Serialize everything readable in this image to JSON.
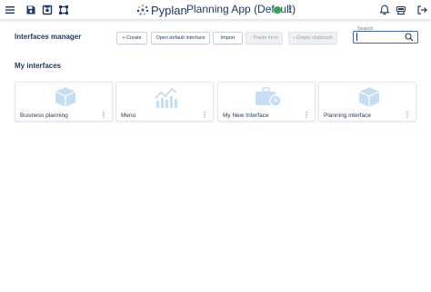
{
  "topbar": {
    "logo_text": "Pyplan",
    "app_title": "Planning App (Default)",
    "status_color": "#2fa84f",
    "left_icons": [
      "menu-icon",
      "save-icon",
      "save-as-icon",
      "crop-icon"
    ],
    "right_icons": [
      "bell-icon",
      "support-icon",
      "logout-icon"
    ]
  },
  "manager": {
    "title": "Interfaces manager",
    "buttons": {
      "create": "+ Create",
      "open_default": "Open default interface",
      "import": "Import",
      "paste": "Paste here",
      "empty_clipboard": "Empty clipboard"
    },
    "search": {
      "label": "Search",
      "value": ""
    }
  },
  "section": {
    "title": "My interfaces"
  },
  "cards": [
    {
      "label": "Business planning",
      "icon": "cube-icon"
    },
    {
      "label": "Menu",
      "icon": "chart-icon"
    },
    {
      "label": "My New Interface",
      "icon": "briefcase-clock-icon"
    },
    {
      "label": "Planning interface",
      "icon": "cube-icon"
    }
  ],
  "colors": {
    "primary": "#1f3b63",
    "icon_light": "#c5def4",
    "accent": "#3a6ab5"
  }
}
